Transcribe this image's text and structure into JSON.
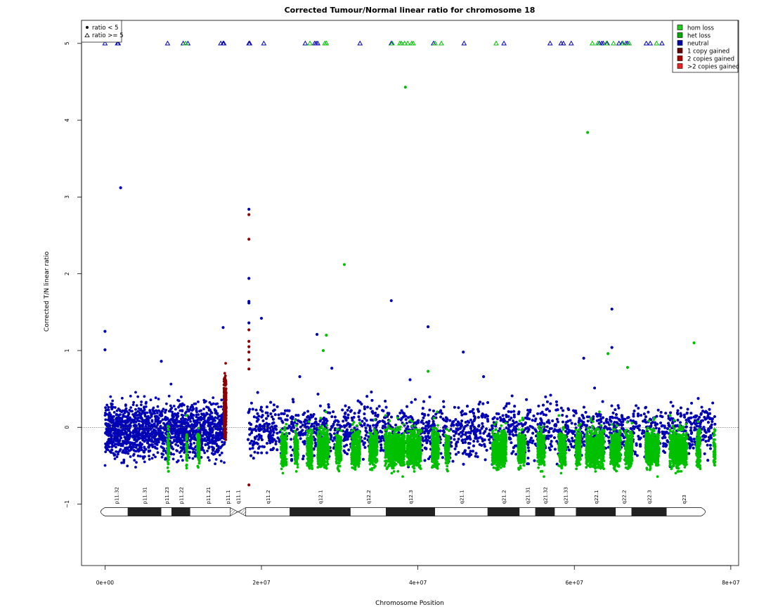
{
  "chart_data": {
    "type": "scatter",
    "title": "Corrected Tumour/Normal linear ratio for chromosome  18",
    "xlabel": "Chromosome Position",
    "ylabel": "Corrected T/N linear ratio",
    "xlim": [
      -3000000,
      81000000
    ],
    "ylim": [
      -1.8,
      5.3
    ],
    "x_ticks": [
      {
        "value": 0,
        "label": "0e+00"
      },
      {
        "value": 20000000,
        "label": "2e+07"
      },
      {
        "value": 40000000,
        "label": "4e+07"
      },
      {
        "value": 60000000,
        "label": "6e+07"
      },
      {
        "value": 80000000,
        "label": "8e+07"
      }
    ],
    "y_ticks": [
      {
        "value": -1,
        "label": "−1"
      },
      {
        "value": 0,
        "label": "0"
      },
      {
        "value": 1,
        "label": "1"
      },
      {
        "value": 2,
        "label": "2"
      },
      {
        "value": 3,
        "label": "3"
      },
      {
        "value": 4,
        "label": "4"
      },
      {
        "value": 5,
        "label": "5"
      }
    ],
    "reference_line_y": 0,
    "grid": false,
    "legend_shape": {
      "position": "top-left",
      "entries": [
        {
          "label": "ratio < 5",
          "marker": "filled-circle"
        },
        {
          "label": "ratio >= 5",
          "marker": "open-triangle"
        }
      ]
    },
    "legend_state": {
      "position": "top-right",
      "entries": [
        {
          "label": "hom loss",
          "color": "#22cc22"
        },
        {
          "label": "het loss",
          "color": "#00aa00"
        },
        {
          "label": "neutral",
          "color": "#0000aa"
        },
        {
          "label": "1 copy gained",
          "color": "#660000"
        },
        {
          "label": "2 copies gained",
          "color": "#aa0000"
        },
        {
          "label": ">2 copies gained",
          "color": "#ee2222"
        }
      ]
    },
    "colors": {
      "neutral": "#0000b4",
      "loss": "#00c000",
      "gain": "#8b0000"
    },
    "dense_regions": {
      "neutral": [
        [
          0,
          15300000
        ],
        [
          18300000,
          78000000
        ]
      ],
      "gain": [
        [
          15200000,
          15500000
        ]
      ],
      "loss": [
        [
          8000000,
          8200000
        ],
        [
          10400000,
          10500000
        ],
        [
          11800000,
          12100000
        ],
        [
          22500000,
          23200000
        ],
        [
          24200000,
          24700000
        ],
        [
          25800000,
          26500000
        ],
        [
          27200000,
          28600000
        ],
        [
          29500000,
          30200000
        ],
        [
          31500000,
          32600000
        ],
        [
          33800000,
          34800000
        ],
        [
          35800000,
          38300000
        ],
        [
          38600000,
          40400000
        ],
        [
          41800000,
          42700000
        ],
        [
          43500000,
          44000000
        ],
        [
          49500000,
          51300000
        ],
        [
          52800000,
          53700000
        ],
        [
          55300000,
          56200000
        ],
        [
          58000000,
          58900000
        ],
        [
          60200000,
          60800000
        ],
        [
          61500000,
          63800000
        ],
        [
          64600000,
          65900000
        ],
        [
          66500000,
          67400000
        ],
        [
          69100000,
          70800000
        ],
        [
          72200000,
          74400000
        ],
        [
          75600000,
          76100000
        ],
        [
          77800000,
          78000000
        ]
      ]
    },
    "outliers": [
      {
        "x": 2000000,
        "y": 3.12,
        "state": "neutral"
      },
      {
        "x": 0,
        "y": 1.25,
        "state": "neutral"
      },
      {
        "x": 0,
        "y": 1.01,
        "state": "neutral"
      },
      {
        "x": 7200000,
        "y": 0.86,
        "state": "neutral"
      },
      {
        "x": 15100000,
        "y": 1.3,
        "state": "neutral"
      },
      {
        "x": 18400000,
        "y": 2.84,
        "state": "neutral"
      },
      {
        "x": 18400000,
        "y": 2.77,
        "state": "gain"
      },
      {
        "x": 18400000,
        "y": 2.45,
        "state": "gain"
      },
      {
        "x": 18400000,
        "y": 1.94,
        "state": "neutral"
      },
      {
        "x": 18400000,
        "y": 1.64,
        "state": "neutral"
      },
      {
        "x": 18400000,
        "y": 1.62,
        "state": "neutral"
      },
      {
        "x": 18400000,
        "y": 1.36,
        "state": "neutral"
      },
      {
        "x": 18400000,
        "y": 1.27,
        "state": "gain"
      },
      {
        "x": 18400000,
        "y": 1.12,
        "state": "gain"
      },
      {
        "x": 18400000,
        "y": 1.05,
        "state": "gain"
      },
      {
        "x": 18400000,
        "y": 0.98,
        "state": "gain"
      },
      {
        "x": 18400000,
        "y": 0.88,
        "state": "gain"
      },
      {
        "x": 18400000,
        "y": 0.76,
        "state": "gain"
      },
      {
        "x": 18400000,
        "y": -0.75,
        "state": "gain"
      },
      {
        "x": 20000000,
        "y": 1.42,
        "state": "neutral"
      },
      {
        "x": 30600000,
        "y": 2.12,
        "state": "loss"
      },
      {
        "x": 27100000,
        "y": 1.21,
        "state": "neutral"
      },
      {
        "x": 28300000,
        "y": 1.2,
        "state": "loss"
      },
      {
        "x": 27900000,
        "y": 1.0,
        "state": "loss"
      },
      {
        "x": 29000000,
        "y": 0.77,
        "state": "neutral"
      },
      {
        "x": 36600000,
        "y": 1.65,
        "state": "neutral"
      },
      {
        "x": 38400000,
        "y": 4.43,
        "state": "loss"
      },
      {
        "x": 41300000,
        "y": 1.31,
        "state": "neutral"
      },
      {
        "x": 41300000,
        "y": 0.73,
        "state": "loss"
      },
      {
        "x": 45800000,
        "y": 0.98,
        "state": "neutral"
      },
      {
        "x": 61700000,
        "y": 3.84,
        "state": "loss"
      },
      {
        "x": 64800000,
        "y": 1.54,
        "state": "neutral"
      },
      {
        "x": 64800000,
        "y": 1.04,
        "state": "neutral"
      },
      {
        "x": 64300000,
        "y": 0.96,
        "state": "loss"
      },
      {
        "x": 61200000,
        "y": 0.9,
        "state": "neutral"
      },
      {
        "x": 66800000,
        "y": 0.78,
        "state": "loss"
      },
      {
        "x": 75300000,
        "y": 1.1,
        "state": "loss"
      },
      {
        "x": 39000000,
        "y": 0.62,
        "state": "neutral"
      },
      {
        "x": 24900000,
        "y": 0.66,
        "state": "neutral"
      },
      {
        "x": 48400000,
        "y": 0.66,
        "state": "neutral"
      }
    ],
    "capped_points": {
      "y": 5,
      "neutral_x": [
        0,
        1600000,
        1700000,
        8000000,
        10000000,
        10600000,
        14800000,
        15100000,
        15200000,
        18400000,
        18500000,
        20300000,
        25600000,
        26800000,
        27000000,
        27200000,
        32600000,
        36600000,
        36700000,
        42000000,
        45900000,
        51000000,
        56900000,
        58300000,
        58600000,
        59600000,
        63200000,
        63500000,
        63700000,
        64200000,
        65700000,
        66100000,
        66600000,
        66800000,
        69200000,
        69700000,
        71200000
      ],
      "loss_x": [
        10300000,
        26200000,
        28100000,
        28300000,
        36700000,
        37700000,
        37900000,
        38300000,
        38700000,
        39200000,
        39400000,
        42200000,
        43000000,
        50000000,
        62300000,
        63000000,
        64100000,
        65000000,
        66200000,
        67000000,
        70500000
      ]
    },
    "ideogram": {
      "y": -1.1,
      "start": 0,
      "end": 76200000,
      "centromere": [
        16000000,
        18000000
      ],
      "bands": [
        {
          "name": "p11.32",
          "start": 0,
          "end": 2900000,
          "stain": "gneg"
        },
        {
          "name": "p11.31",
          "start": 2900000,
          "end": 7200000,
          "stain": "gpos"
        },
        {
          "name": "p11.23",
          "start": 7200000,
          "end": 8500000,
          "stain": "gneg"
        },
        {
          "name": "p11.22",
          "start": 8500000,
          "end": 10900000,
          "stain": "gpos"
        },
        {
          "name": "p11.21",
          "start": 10900000,
          "end": 15400000,
          "stain": "gneg"
        },
        {
          "name": "p11.1",
          "start": 15400000,
          "end": 16000000,
          "stain": "gneg"
        },
        {
          "name": "q11.1",
          "start": 16000000,
          "end": 18000000,
          "stain": "acen"
        },
        {
          "name": "q11.2",
          "start": 18000000,
          "end": 23600000,
          "stain": "gneg"
        },
        {
          "name": "q12.1",
          "start": 23600000,
          "end": 31400000,
          "stain": "gpos"
        },
        {
          "name": "q12.2",
          "start": 31400000,
          "end": 35900000,
          "stain": "gneg"
        },
        {
          "name": "q12.3",
          "start": 35900000,
          "end": 42200000,
          "stain": "gpos"
        },
        {
          "name": "q21.1",
          "start": 42200000,
          "end": 48900000,
          "stain": "gneg"
        },
        {
          "name": "q21.2",
          "start": 48900000,
          "end": 53000000,
          "stain": "gpos"
        },
        {
          "name": "q21.31",
          "start": 53000000,
          "end": 55000000,
          "stain": "gneg"
        },
        {
          "name": "q21.32",
          "start": 55000000,
          "end": 57500000,
          "stain": "gpos"
        },
        {
          "name": "q21.33",
          "start": 57500000,
          "end": 60200000,
          "stain": "gneg"
        },
        {
          "name": "q22.1",
          "start": 60200000,
          "end": 65300000,
          "stain": "gpos"
        },
        {
          "name": "q22.2",
          "start": 65300000,
          "end": 67300000,
          "stain": "gneg"
        },
        {
          "name": "q22.3",
          "start": 67300000,
          "end": 71800000,
          "stain": "gpos"
        },
        {
          "name": "q23",
          "start": 71800000,
          "end": 76200000,
          "stain": "gneg"
        }
      ]
    }
  }
}
